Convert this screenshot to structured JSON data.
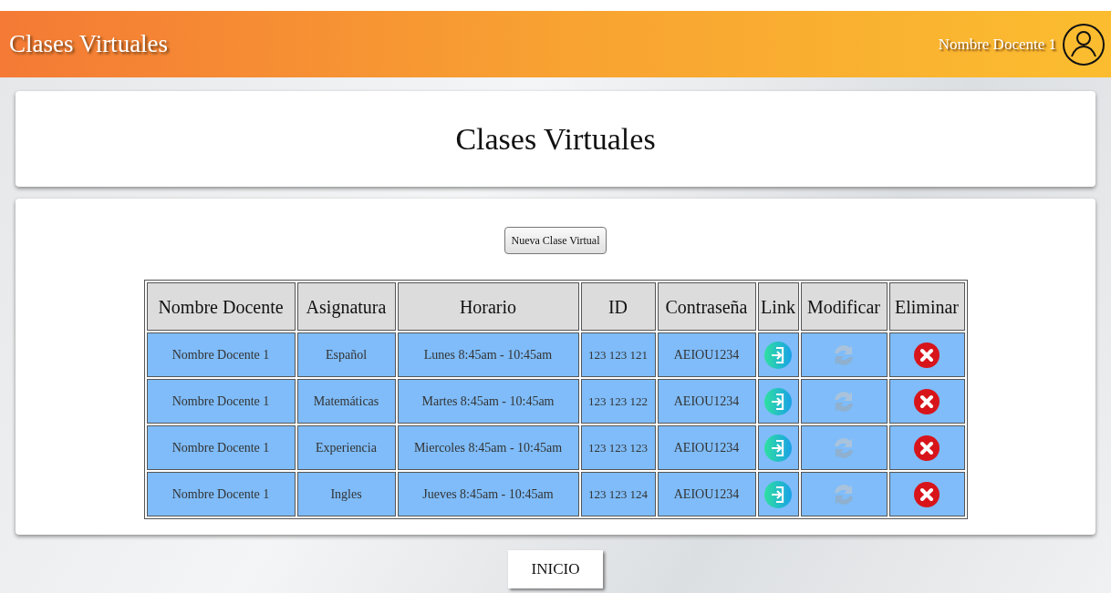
{
  "header": {
    "title": "Clases Virtuales",
    "user_name": "Nombre Docente 1"
  },
  "page_title": "Clases Virtuales",
  "new_button": "Nueva Clase Virtual",
  "table": {
    "columns": [
      "Nombre Docente",
      "Asignatura",
      "Horario",
      "ID",
      "Contraseña",
      "Link",
      "Modificar",
      "Eliminar"
    ],
    "rows": [
      {
        "docente": "Nombre Docente 1",
        "asignatura": "Español",
        "horario": "Lunes 8:45am - 10:45am",
        "id": "123 123 121",
        "password": "AEIOU1234"
      },
      {
        "docente": "Nombre Docente 1",
        "asignatura": "Matemáticas",
        "horario": "Martes 8:45am - 10:45am",
        "id": "123 123 122",
        "password": "AEIOU1234"
      },
      {
        "docente": "Nombre Docente 1",
        "asignatura": "Experiencia",
        "horario": "Miercoles 8:45am - 10:45am",
        "id": "123 123 123",
        "password": "AEIOU1234"
      },
      {
        "docente": "Nombre Docente 1",
        "asignatura": "Ingles",
        "horario": "Jueves 8:45am - 10:45am",
        "id": "123 123 124",
        "password": "AEIOU1234"
      }
    ]
  },
  "home_button": "INICIO"
}
